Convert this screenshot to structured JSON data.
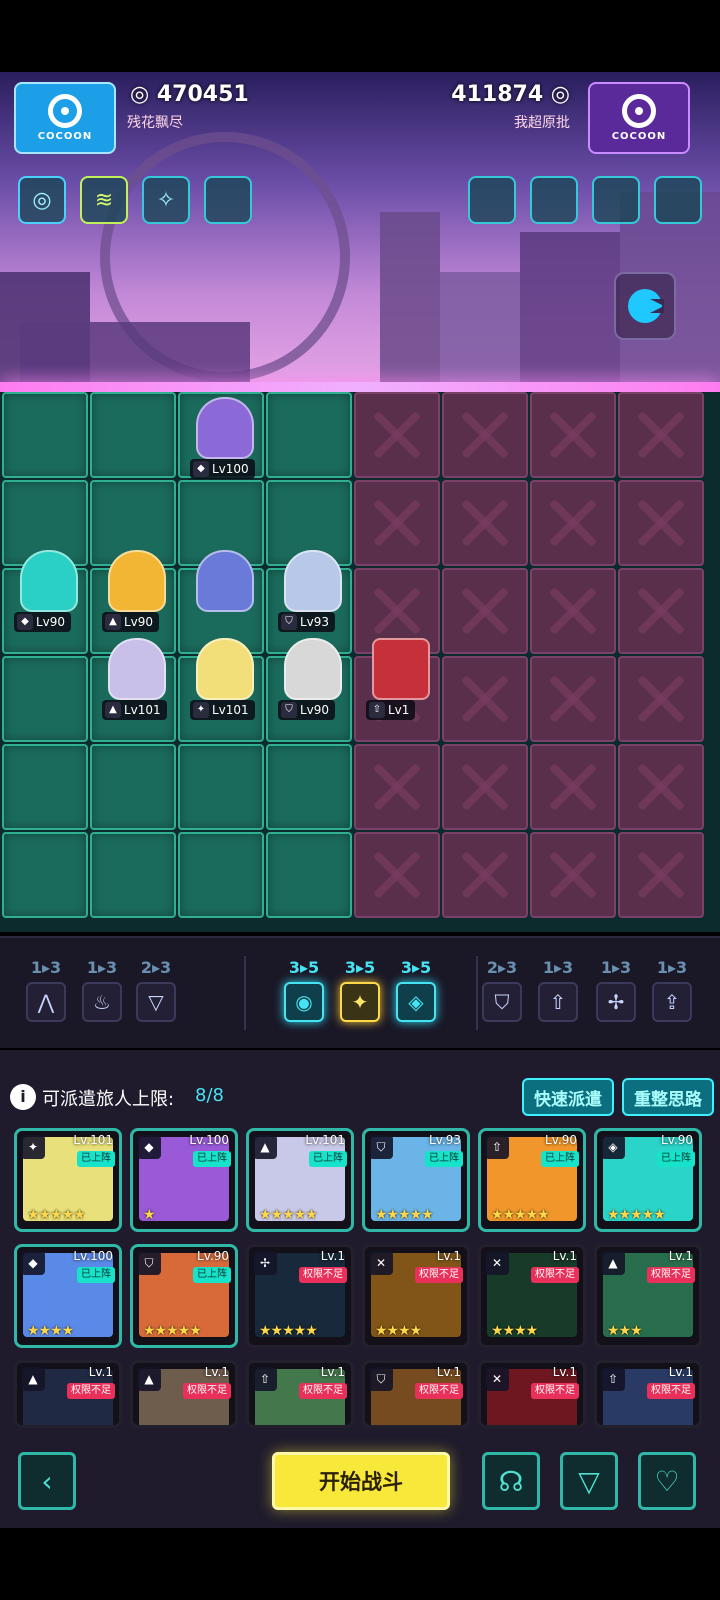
{
  "header": {
    "left_player": {
      "logo_text": "COCOON",
      "score": "470451",
      "name": "残花飘尽"
    },
    "right_player": {
      "logo_text": "COCOON",
      "score": "411874",
      "name": "我超原批"
    }
  },
  "buffs_left": [
    {
      "icon": "swirl-icon"
    },
    {
      "icon": "wave-icon"
    },
    {
      "icon": "sparkle-icon"
    },
    {
      "icon": "empty-slot"
    }
  ],
  "buffs_right": [
    {
      "icon": "empty-slot"
    },
    {
      "icon": "empty-slot"
    },
    {
      "icon": "empty-slot"
    },
    {
      "icon": "empty-slot"
    }
  ],
  "board": {
    "units": [
      {
        "level": "Lv100",
        "color": "#8b6ad8"
      },
      {
        "level": "Lv90",
        "color": "#2bd0c4"
      },
      {
        "level": "Lv90",
        "color": "#f2b634"
      },
      {
        "level": "Lv93",
        "color": "#b8c8e8"
      },
      {
        "level": "Lv101",
        "color": "#c8c0e8"
      },
      {
        "level": "Lv101",
        "color": "#f3df7a"
      },
      {
        "level": "Lv90",
        "color": "#d8d8d8"
      },
      {
        "level": "Lv1",
        "color": "#c6303a"
      }
    ]
  },
  "traits": [
    {
      "count": "1▸3",
      "icon": "mountain-icon",
      "active": false
    },
    {
      "count": "1▸3",
      "icon": "flame-icon",
      "active": false
    },
    {
      "count": "2▸3",
      "icon": "triangle-icon",
      "active": false
    },
    {
      "count": "3▸5",
      "icon": "vortex-icon",
      "active": true
    },
    {
      "count": "3▸5",
      "icon": "star-icon",
      "active": true
    },
    {
      "count": "3▸5",
      "icon": "diamond-icon",
      "active": true
    },
    {
      "count": "2▸3",
      "icon": "shield-icon",
      "active": false
    },
    {
      "count": "1▸3",
      "icon": "arrow-up-icon",
      "active": false
    },
    {
      "count": "1▸3",
      "icon": "crossbow-icon",
      "active": false
    },
    {
      "count": "1▸3",
      "icon": "rocket-icon",
      "active": false
    }
  ],
  "roster": {
    "capacity_label": "可派遣旅人上限:",
    "capacity_value": "8/8",
    "quick_dispatch": "快速派遣",
    "reset_thinking": "重整思路",
    "cards": [
      {
        "level": "Lv.101",
        "status": "已上阵",
        "deployed": true,
        "stars": "★★★★★",
        "color": "#e8e07a"
      },
      {
        "level": "Lv.100",
        "status": "已上阵",
        "deployed": true,
        "stars": "★",
        "color": "#9a5ad8"
      },
      {
        "level": "Lv.101",
        "status": "已上阵",
        "deployed": true,
        "stars": "★★★★★",
        "color": "#c8c8e8"
      },
      {
        "level": "Lv.93",
        "status": "已上阵",
        "deployed": true,
        "stars": "★★★★★",
        "color": "#6ab4e8"
      },
      {
        "level": "Lv.90",
        "status": "已上阵",
        "deployed": true,
        "stars": "★★★★★",
        "color": "#f0962a"
      },
      {
        "level": "Lv.90",
        "status": "已上阵",
        "deployed": true,
        "stars": "★★★★★",
        "color": "#2ad4c8"
      },
      {
        "level": "Lv.100",
        "status": "已上阵",
        "deployed": true,
        "stars": "★★★★",
        "color": "#5a8ae8"
      },
      {
        "level": "Lv.90",
        "status": "已上阵",
        "deployed": true,
        "stars": "★★★★★",
        "color": "#d86a3a"
      },
      {
        "level": "Lv.1",
        "status": "权限不足",
        "deployed": false,
        "stars": "★★★★★",
        "color": "#2a4a6a"
      },
      {
        "level": "Lv.1",
        "status": "权限不足",
        "deployed": false,
        "stars": "★★★★",
        "color": "#e89a2a"
      },
      {
        "level": "Lv.1",
        "status": "权限不足",
        "deployed": false,
        "stars": "★★★★",
        "color": "#2a6a4a"
      },
      {
        "level": "Lv.1",
        "status": "权限不足",
        "deployed": false,
        "stars": "★★★",
        "color": "#4ac88a"
      },
      {
        "level": "Lv.1",
        "status": "权限不足",
        "deployed": false,
        "stars": "",
        "color": "#3a4a7a"
      },
      {
        "level": "Lv.1",
        "status": "权限不足",
        "deployed": false,
        "stars": "",
        "color": "#c8a88a"
      },
      {
        "level": "Lv.1",
        "status": "权限不足",
        "deployed": false,
        "stars": "",
        "color": "#7ad88a"
      },
      {
        "level": "Lv.1",
        "status": "权限不足",
        "deployed": false,
        "stars": "",
        "color": "#d8883a"
      },
      {
        "level": "Lv.1",
        "status": "权限不足",
        "deployed": false,
        "stars": "",
        "color": "#c82a3a"
      },
      {
        "level": "Lv.1",
        "status": "权限不足",
        "deployed": false,
        "stars": "",
        "color": "#4a6ab8"
      }
    ]
  },
  "actions": {
    "start_battle": "开始战斗",
    "back_icon": "chevron-left-icon",
    "brain_icon": "brain-icon",
    "filter_icon": "filter-icon",
    "handshake_icon": "handshake-icon"
  },
  "colors": {
    "accent": "#46e3f2",
    "start_button": "#f7e83a",
    "ally_tile": "#1b6b5c",
    "enemy_tile": "#5a2f4c"
  }
}
